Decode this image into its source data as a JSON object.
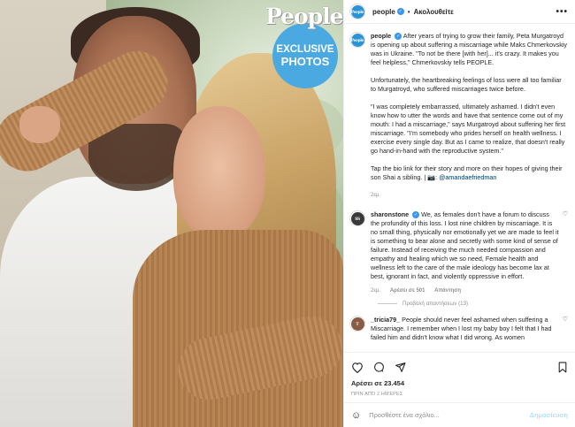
{
  "post": {
    "photo_alt_badge": {
      "logo": "People",
      "line1": "EXCLUSIVE",
      "line2": "PHOTOS"
    }
  },
  "header": {
    "username": "people",
    "separator": "•",
    "follow_label": "Ακολουθείτε",
    "more_label": "•••",
    "avatar_text": "People"
  },
  "caption": {
    "username": "people",
    "paragraphs": [
      "After years of trying to grow their family, Peta Murgatroyd is opening up about suffering a miscarriage while Maks Chmerkovskiy was in Ukraine. \"To not be there [with her]... it's crazy. It makes you feel helpless,\" Chmerkovskiy tells PEOPLE.",
      "Unfortunately, the heartbreaking feelings of loss were all too familiar to Murgatroyd, who suffered miscarriages twice before.",
      "\"I was completely embarrassed, ultimately ashamed. I didn't even know how to utter the words and have that sentence come out of my mouth: I had a miscarriage,\" says Murgatroyd about suffering her first miscarriage. \"I'm somebody who prides herself on health wellness. I exercise every single day. But as I came to realize, that doesn't really go hand-in-hand with the reproductive system.\""
    ],
    "last_paragraph": "Tap the bio link for their story and more on their hopes of giving their son Shai a sibling. | 📷: ",
    "mention": "@amandaefriedman",
    "time": "2εμ."
  },
  "comments": [
    {
      "username": "sharonstone",
      "avatar_text": "SS",
      "text": "We, as females don't have a forum to discuss the profundity of this loss. I lost nine children by miscarriage. It is no small thing, physically nor emotionally yet we are made to feel it is something to bear alone and secretly with some kind of sense of failure. Instead of receiving the much needed compassion and empathy and healing which we so need, Female health and wellness left to the care of the male ideology has become lax at best, ignorant in fact, and violently oppressive in effort.",
      "time": "2εμ.",
      "likes": "Αρέσει σε 501",
      "reply_label": "Απάντηση",
      "view_replies": "Προβολή απαντήσεων (13)"
    },
    {
      "username": "_tricia79_",
      "avatar_text": "T",
      "text": "People should never feel ashamed when suffering a Miscarriage. I remember when I lost my baby boy I felt that I had failed him and didn't know what I did wrong. As women"
    }
  ],
  "actions": {
    "likes": "Αρέσει σε 23.454",
    "date": "ΠΡΙΝ ΑΠΌ 2 ΗΜΈΡΕΣ"
  },
  "composer": {
    "emoji": "☺",
    "placeholder": "Προσθέστε ένα σχόλιο...",
    "publish_label": "Δημοσίευση"
  }
}
